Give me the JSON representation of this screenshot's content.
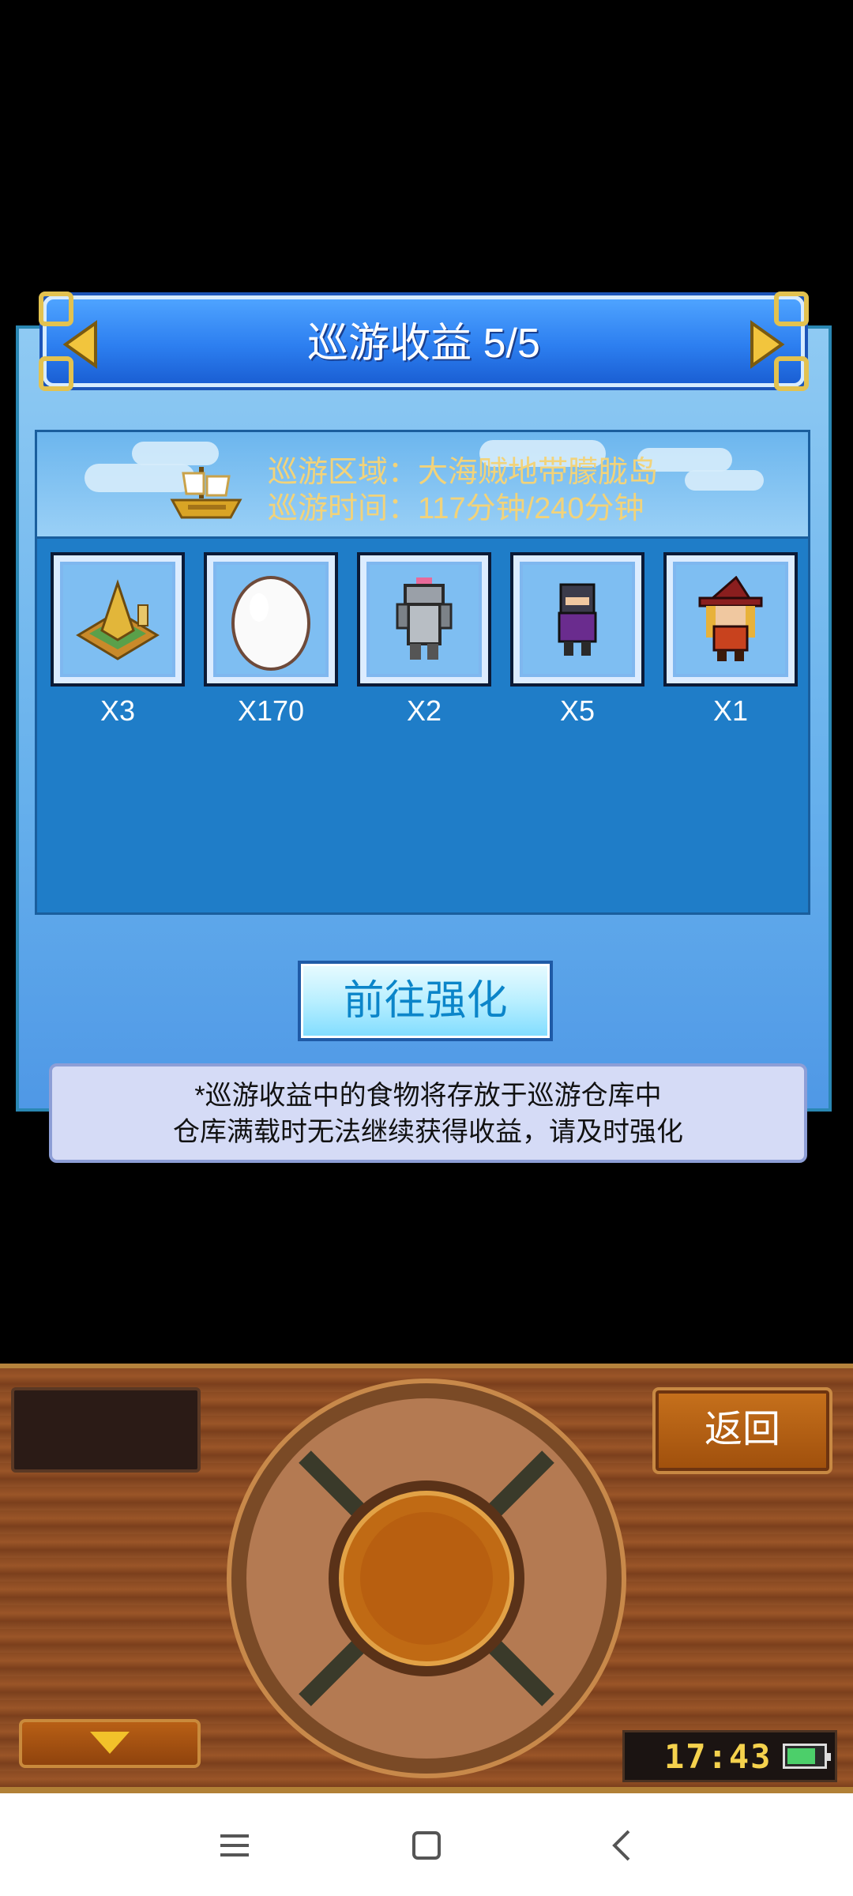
{
  "dialog": {
    "title": "巡游收益 5/5",
    "cruise_area": "巡游区域：大海贼地带朦胧岛",
    "cruise_time": "巡游时间：117分钟/240分钟",
    "items": [
      {
        "icon": "golden-pyramid-icon",
        "count": "X3"
      },
      {
        "icon": "egg-icon",
        "count": "X170"
      },
      {
        "icon": "armor-icon",
        "count": "X2"
      },
      {
        "icon": "ninja-character-icon",
        "count": "X5"
      },
      {
        "icon": "witch-character-icon",
        "count": "X1"
      }
    ],
    "go_button": "前往强化",
    "notice_line1": "*巡游收益中的食物将存放于巡游仓库中",
    "notice_line2": "仓库满载时无法继续获得收益，请及时强化"
  },
  "console": {
    "back_label": "返回",
    "clock": "17:43",
    "battery_level": 0.8
  },
  "colors": {
    "title_blue": "#2d7ff0",
    "cruise_text": "#f2d37a",
    "panel_blue": "#1f7dc8",
    "console_wood": "#8a4a22"
  }
}
